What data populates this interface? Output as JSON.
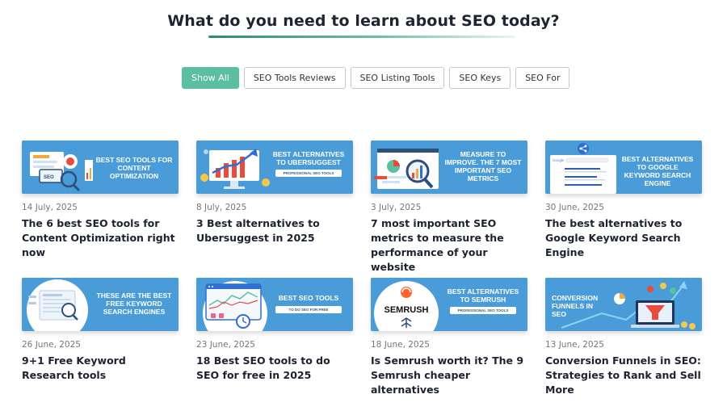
{
  "page": {
    "title": "What do you need to learn about SEO today?"
  },
  "filters": [
    {
      "label": "Show All",
      "active": true
    },
    {
      "label": "SEO Tools Reviews",
      "active": false
    },
    {
      "label": "SEO Listing Tools",
      "active": false
    },
    {
      "label": "SEO Keys",
      "active": false
    },
    {
      "label": "SEO For",
      "active": false
    }
  ],
  "articles": [
    {
      "date": "14 July, 2025",
      "title": "The 6 best SEO tools for Content Optimization right now",
      "thumb_text": "BEST SEO TOOLS FOR CONTENT OPTIMIZATION",
      "thumb_icon": "seo-magnifier-illustration-icon"
    },
    {
      "date": "8 July, 2025",
      "title": "3 Best alternatives to Ubersuggest in 2025",
      "thumb_text": "BEST ALTERNATIVES TO UBERSUGGEST",
      "thumb_sub": "PROFESSIONAL SEO TOOLS",
      "thumb_icon": "growth-chart-monitor-icon"
    },
    {
      "date": "3 July, 2025",
      "title": "7 most important SEO metrics to measure the performance of your website",
      "thumb_text": "MEASURE TO IMPROVE. THE 7 MOST IMPORTANT SEO METRICS",
      "thumb_icon": "metrics-magnifier-icon"
    },
    {
      "date": "30 June, 2025",
      "title": "The best alternatives to Google Keyword Search Engine",
      "thumb_text": "BEST ALTERNATIVES TO GOOGLE KEYWORD SEARCH ENGINE",
      "thumb_icon": "google-search-page-icon"
    },
    {
      "date": "26 June, 2025",
      "title": "9+1 Free Keyword Research tools",
      "thumb_text": "THESE ARE THE BEST FREE KEYWORD SEARCH ENGINES",
      "thumb_icon": "keyword-search-circle-icon"
    },
    {
      "date": "23 June, 2025",
      "title": "18 Best SEO tools to do SEO for free in 2025",
      "thumb_text": "BEST SEO TOOLS",
      "thumb_sub": "TO DO SEO FOR FREE",
      "thumb_icon": "browser-dashboard-icon"
    },
    {
      "date": "18 June, 2025",
      "title": "Is Semrush worth it? The 9 Semrush cheaper alternatives",
      "thumb_text": "BEST ALTERNATIVES TO SEMRUSH",
      "thumb_sub": "PROFESSIONAL SEO TOOLS",
      "thumb_logo": "SEMRUSH",
      "thumb_icon": "semrush-logo-icon"
    },
    {
      "date": "13 June, 2025",
      "title": "Conversion Funnels in SEO: Strategies to Rank and Sell More",
      "thumb_text": "CONVERSION FUNNELS IN SEO",
      "thumb_icon": "conversion-funnel-laptop-icon"
    }
  ],
  "colors": {
    "accent": "#5cbfa2",
    "thumb_bg": "#4a9cd8",
    "title": "#1f2530"
  }
}
